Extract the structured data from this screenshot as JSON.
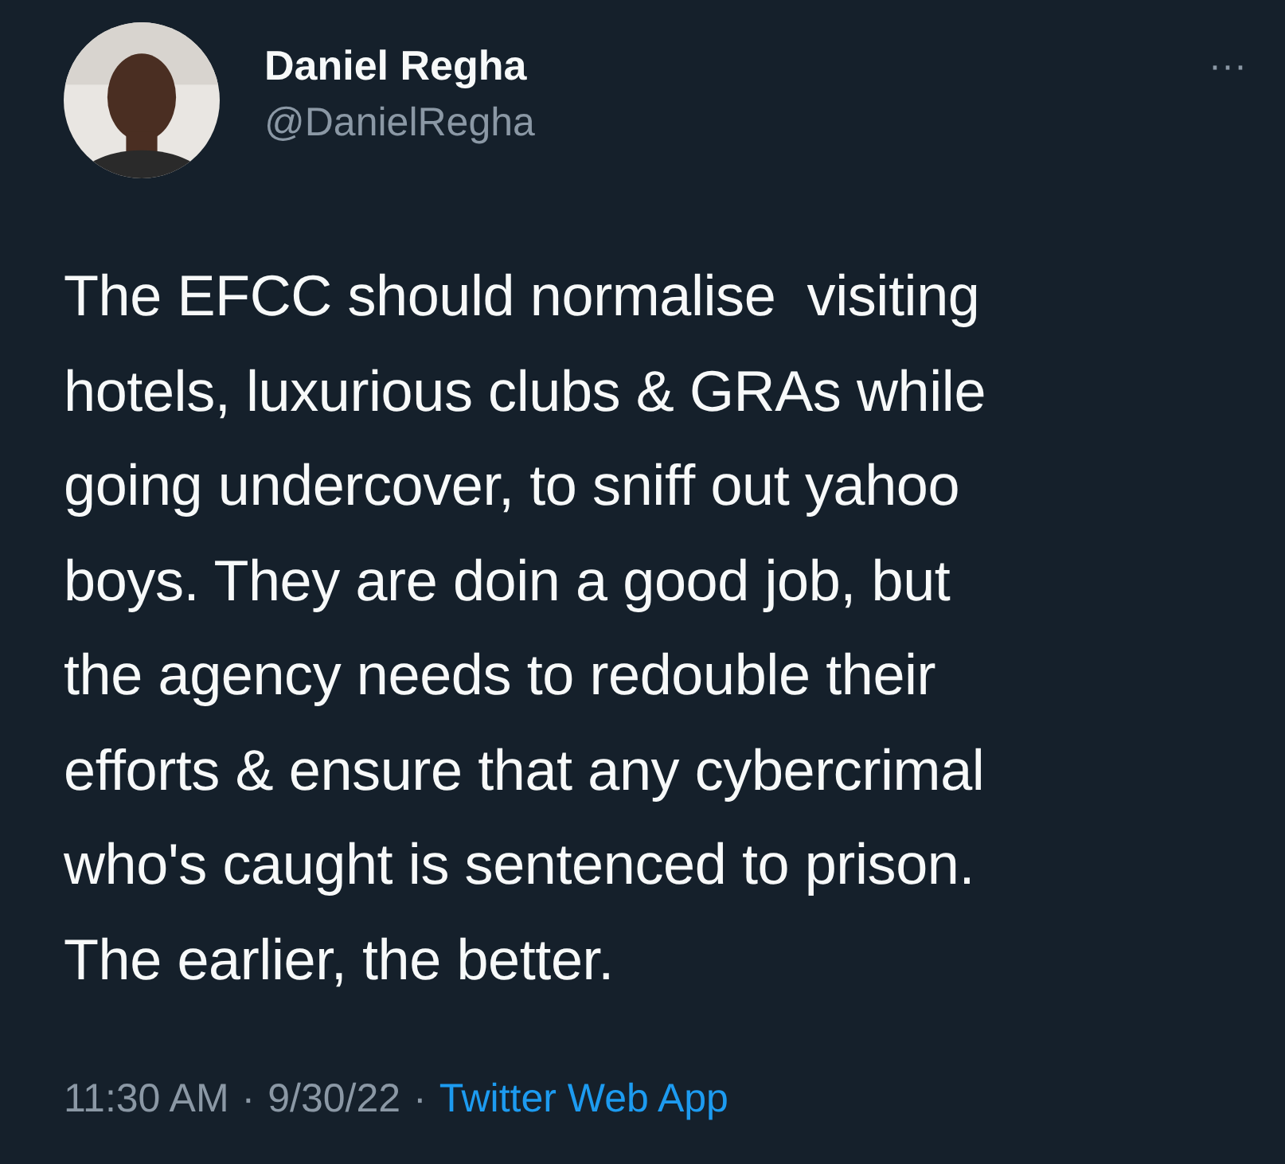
{
  "author": {
    "name": "Daniel Regha",
    "handle": "@DanielRegha"
  },
  "menu": "···",
  "text_lines": [
    "The EFCC should normalise  visiting",
    "hotels, luxurious clubs & GRAs while",
    "going undercover, to sniff out yahoo",
    "boys. They are doin a good job, but",
    "the agency needs to redouble their",
    "efforts & ensure that any cybercrimal",
    "who's caught is sentenced to prison.",
    "The earlier, the better."
  ],
  "footer": {
    "time": "11:30 AM",
    "date": "9/30/22",
    "separator": "·",
    "source": "Twitter Web App"
  }
}
